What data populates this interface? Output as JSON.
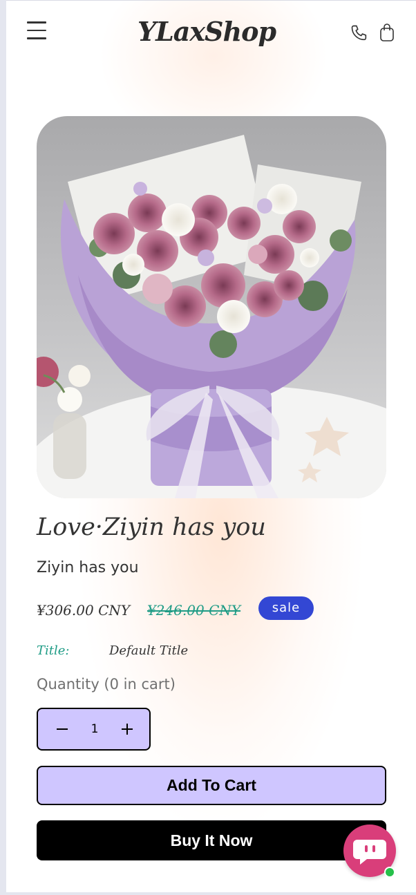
{
  "header": {
    "logo": "YLaxShop",
    "icons": {
      "menu": "hamburger-menu-icon",
      "phone": "phone-icon",
      "cart": "shopping-bag-icon"
    }
  },
  "product": {
    "image_icon": "flower-bouquet-image",
    "title": "Love·Ziyin has you",
    "subtitle": "Ziyin has you",
    "price": "¥306.00 CNY",
    "compare_price": "¥246.00 CNY",
    "badge": "sale",
    "option": {
      "label": "Title:",
      "value": "Default Title"
    },
    "quantity_label": "Quantity (0 in cart)",
    "quantity": "1"
  },
  "actions": {
    "add_to_cart": "Add To Cart",
    "buy_now": "Buy It Now"
  },
  "chat": {
    "icon": "chat-bubble-icon",
    "status": "online"
  },
  "colors": {
    "accent_lavender": "#cfc6ff",
    "sale_badge": "#3347d4",
    "compare_price": "#1f9c86",
    "chat_button": "#d93e7a",
    "online": "#26c04a"
  }
}
